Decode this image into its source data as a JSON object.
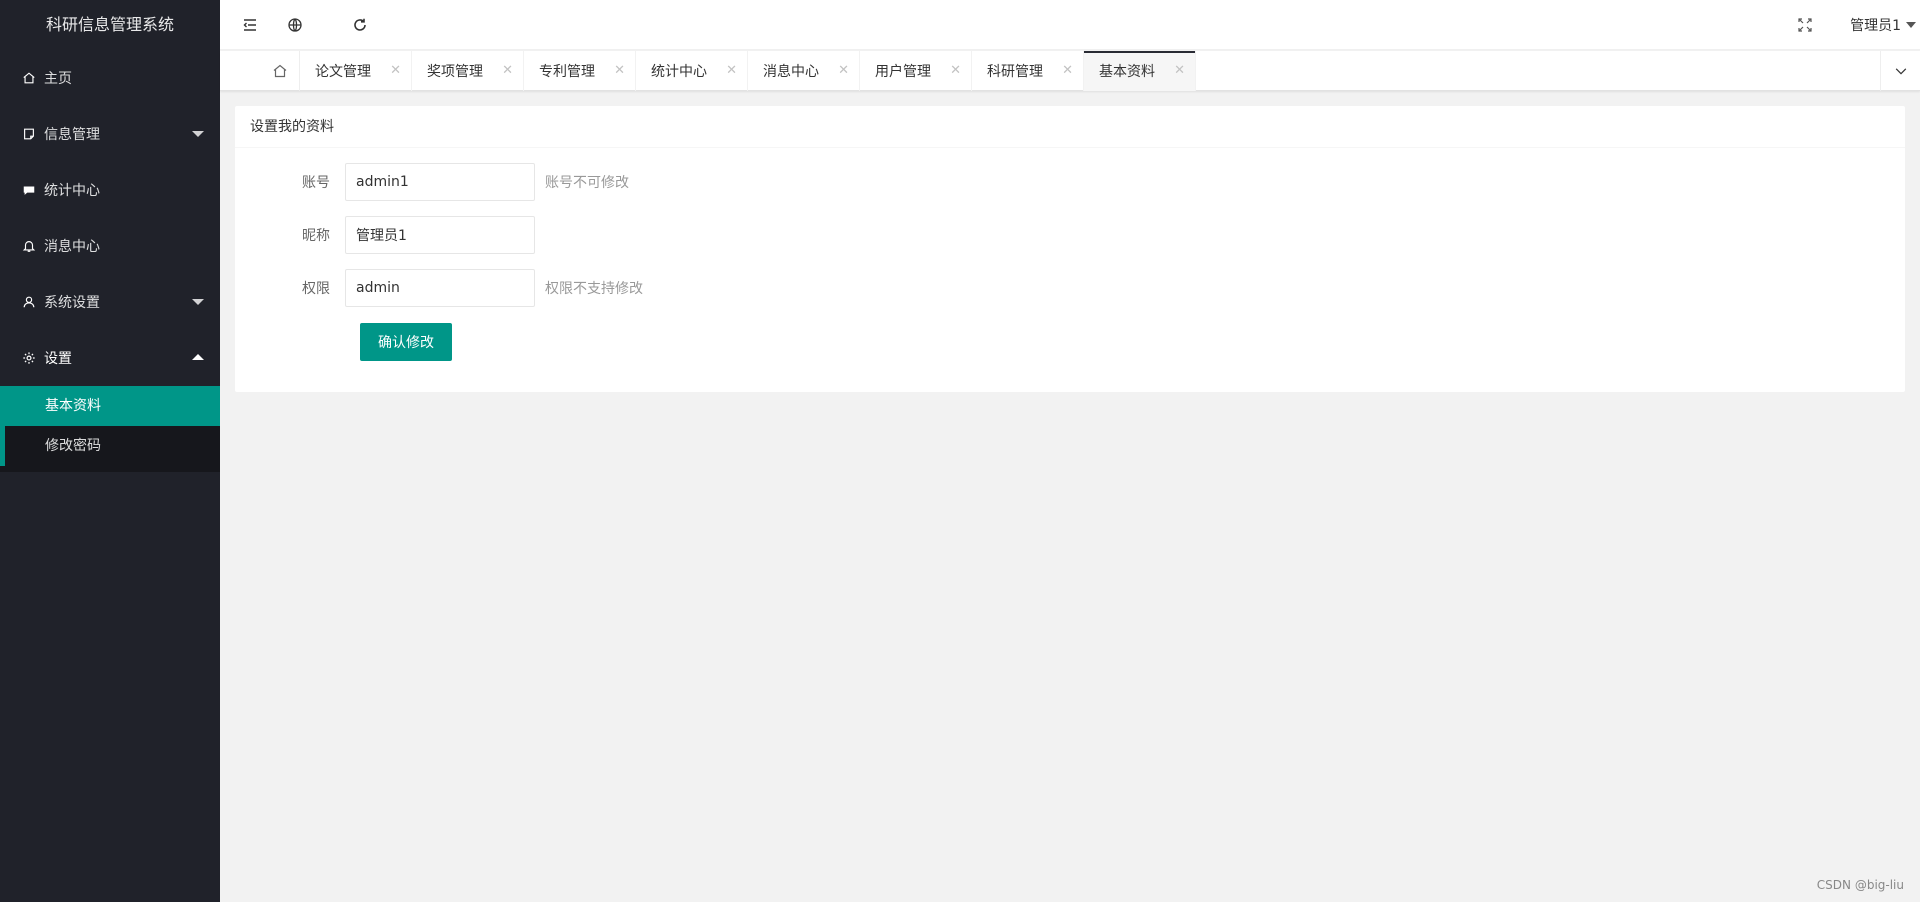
{
  "app": {
    "title": "科研信息管理系统"
  },
  "sidebar": {
    "items": [
      {
        "label": "主页",
        "icon": "home-icon"
      },
      {
        "label": "信息管理",
        "icon": "document-icon"
      },
      {
        "label": "统计中心",
        "icon": "chat-icon"
      },
      {
        "label": "消息中心",
        "icon": "bell-icon"
      },
      {
        "label": "系统设置",
        "icon": "user-icon"
      },
      {
        "label": "设置",
        "icon": "gear-icon"
      }
    ],
    "sub_items": [
      {
        "label": "基本资料"
      },
      {
        "label": "修改密码"
      }
    ]
  },
  "header": {
    "user_name": "管理员1"
  },
  "tabs": [
    {
      "label": "论文管理"
    },
    {
      "label": "奖项管理"
    },
    {
      "label": "专利管理"
    },
    {
      "label": "统计中心"
    },
    {
      "label": "消息中心"
    },
    {
      "label": "用户管理"
    },
    {
      "label": "科研管理"
    },
    {
      "label": "基本资料"
    }
  ],
  "form": {
    "title": "设置我的资料",
    "account": {
      "label": "账号",
      "value": "admin1",
      "aux": "账号不可修改"
    },
    "nickname": {
      "label": "昵称",
      "value": "管理员1"
    },
    "role": {
      "label": "权限",
      "value": "admin",
      "aux": "权限不支持修改"
    },
    "submit_label": "确认修改"
  },
  "watermark": "CSDN @big-liu",
  "colors": {
    "sidebar_bg": "#20222a",
    "accent": "#009688",
    "page_bg": "#f2f2f2"
  }
}
